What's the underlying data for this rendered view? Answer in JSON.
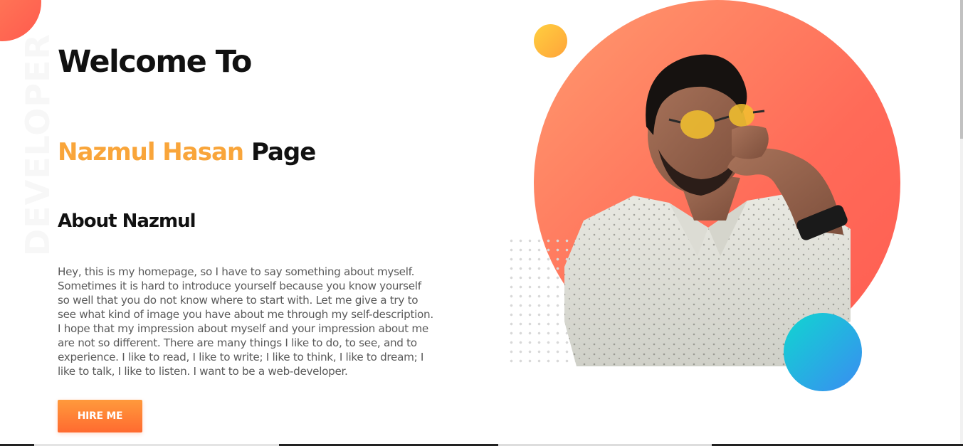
{
  "hero": {
    "side_word": "DEVELOPER",
    "title": "Welcome To",
    "name": "Nazmul Hasan",
    "page_word": "Page"
  },
  "about": {
    "title": "About Nazmul",
    "text": "Hey, this is my homepage, so I have to say something about myself. Sometimes it is hard to introduce yourself because you know yourself so well that you do not know where to start with. Let me give a try to see what kind of image you have about me through my self-description. I hope that my impression about myself and your impression about me are not so different. There are many things I like to do, to see, and to experience. I like to read, I like to write; I like to think, I like to dream; I like to talk, I like to listen. I want to be a web-developer."
  },
  "cta": {
    "label": "HIRE ME"
  },
  "colors": {
    "accent": "#f9a53a",
    "button": "#ff7a35",
    "circle": "#ff6a58",
    "blue_dot": "#2fa6e6",
    "yellow_dot": "#ffbe3b"
  },
  "icons": {
    "portrait": "portrait-photo"
  }
}
